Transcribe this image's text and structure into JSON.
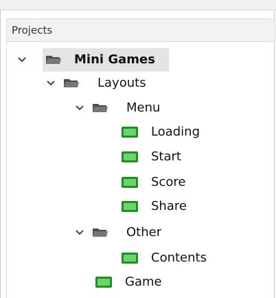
{
  "panel": {
    "title": "Projects"
  },
  "tree": {
    "root": {
      "label": "Mini Games",
      "expanded": true,
      "icon": "folder-icon"
    },
    "layouts": {
      "label": "Layouts",
      "expanded": true,
      "icon": "folder-icon"
    },
    "menu": {
      "label": "Menu",
      "expanded": true,
      "icon": "folder-icon"
    },
    "menu_items": [
      {
        "label": "Loading",
        "icon": "layout-icon"
      },
      {
        "label": "Start",
        "icon": "layout-icon"
      },
      {
        "label": "Score",
        "icon": "layout-icon"
      },
      {
        "label": "Share",
        "icon": "layout-icon"
      }
    ],
    "other": {
      "label": "Other",
      "expanded": true,
      "icon": "folder-icon"
    },
    "other_items": [
      {
        "label": "Contents",
        "icon": "layout-icon"
      }
    ],
    "layout_items": [
      {
        "label": "Game",
        "icon": "layout-icon"
      }
    ]
  },
  "colors": {
    "accent_green": "#33b133",
    "folder_dark": "#3b3b3b",
    "highlight": "#e4e4e4"
  }
}
